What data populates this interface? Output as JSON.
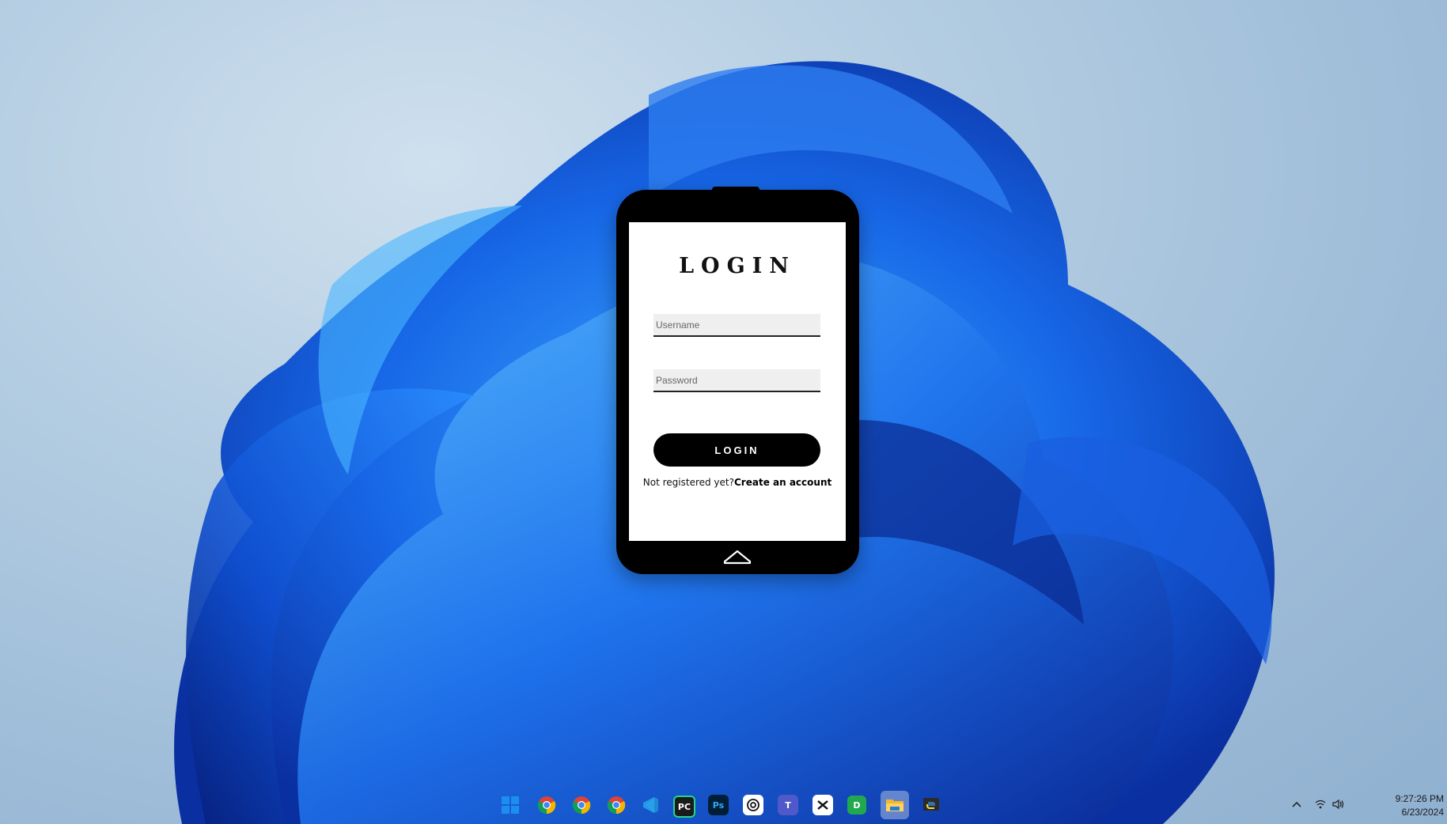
{
  "app": {
    "title": "LOGIN",
    "username_placeholder": "Username",
    "password_placeholder": "Password",
    "login_button": "LOGIN",
    "register_prompt": "Not registered yet?",
    "register_link": "Create an account"
  },
  "taskbar": {
    "icons": [
      {
        "name": "windows-start-icon"
      },
      {
        "name": "chrome-icon"
      },
      {
        "name": "chrome-icon"
      },
      {
        "name": "chrome-icon"
      },
      {
        "name": "vscode-icon"
      },
      {
        "name": "pycharm-icon",
        "text": "PC"
      },
      {
        "name": "photoshop-icon",
        "text": "Ps"
      },
      {
        "name": "chatgpt-icon"
      },
      {
        "name": "teams-icon",
        "text": "T"
      },
      {
        "name": "capcut-icon"
      },
      {
        "name": "app-d-icon",
        "text": "D"
      },
      {
        "name": "file-explorer-icon"
      },
      {
        "name": "python-icon"
      }
    ]
  },
  "tray": {
    "time": "9:27:26 PM",
    "date": "6/23/2024"
  },
  "colors": {
    "accent": "#000000",
    "screen": "#ffffff",
    "field_bg": "#efefef"
  }
}
